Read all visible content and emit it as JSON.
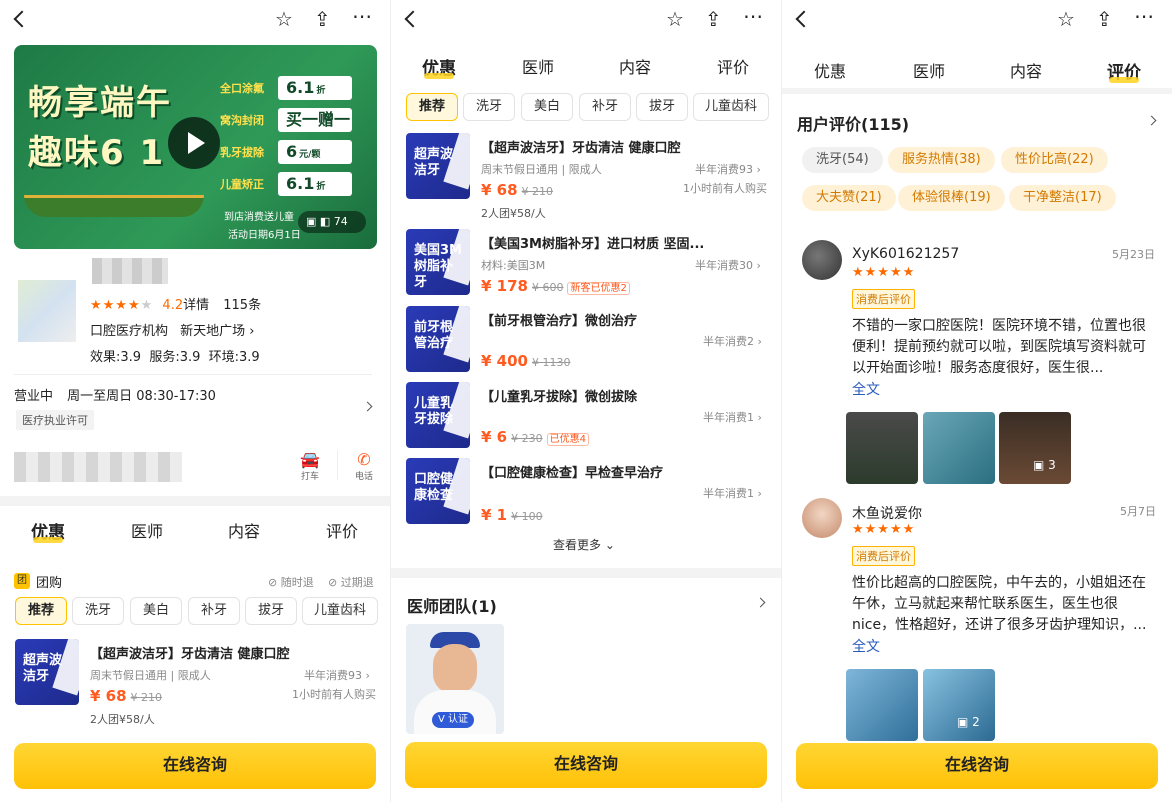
{
  "p1": {
    "banner": {
      "headline1": "畅享端午",
      "headline2": "趣味6 1",
      "offers": [
        {
          "label": "全口涂氟",
          "value": "6.1",
          "unit": "折"
        },
        {
          "label": "窝沟封闭",
          "value": "买一赠一",
          "unit": ""
        },
        {
          "label": "乳牙拔除",
          "value": "6",
          "unit": "元/颗"
        },
        {
          "label": "儿童矫正",
          "value": "6.1",
          "unit": "折"
        }
      ],
      "footnote1": "到店消费送儿童",
      "footnote2": "活动日期6月1日",
      "media_count": "74"
    },
    "rating_value": "4.2",
    "rating_details": "详情",
    "review_count": "115条",
    "category": "口腔医疗机构",
    "area": "新天地广场",
    "scores": "效果:3.9  服务:3.9  环境:3.9",
    "hours_status": "营业中",
    "hours_text": "周一至周日 08:30-17:30",
    "license": "医疗执业许可",
    "taxi_label": "打车",
    "phone_label": "电话",
    "tabs": [
      "优惠",
      "医师",
      "内容",
      "评价"
    ],
    "group_badge": "团",
    "group_title": "团购",
    "refund1": "随时退",
    "refund2": "过期退",
    "chips": [
      "推荐",
      "洗牙",
      "美白",
      "补牙",
      "拔牙",
      "儿童齿科"
    ],
    "deal": {
      "img_text": "超声波洁牙",
      "title": "【超声波洁牙】牙齿清洁 健康口腔",
      "sub": "周末节假日通用 | 限成人",
      "price": "¥ 68",
      "orig": "¥ 210",
      "sold": "半年消费93",
      "recent": "1小时前有人购买",
      "group": "2人团¥58/人"
    },
    "cta": "在线咨询"
  },
  "p2": {
    "tabs": [
      "优惠",
      "医师",
      "内容",
      "评价"
    ],
    "chips": [
      "推荐",
      "洗牙",
      "美白",
      "补牙",
      "拔牙",
      "儿童齿科"
    ],
    "deals": [
      {
        "img": "超声波洁牙",
        "title": "【超声波洁牙】牙齿清洁 健康口腔",
        "sub": "周末节假日通用 | 限成人",
        "price": "¥ 68",
        "orig": "¥ 210",
        "coupon": "",
        "sold": "半年消费93",
        "recent": "1小时前有人购买",
        "group": "2人团¥58/人"
      },
      {
        "img": "美国3M树脂补牙",
        "title": "【美国3M树脂补牙】进口材质 坚固...",
        "sub": "材料:美国3M",
        "price": "¥ 178",
        "orig": "¥ 600",
        "coupon": "新客已优惠2",
        "sold": "半年消费30",
        "recent": "",
        "group": ""
      },
      {
        "img": "前牙根管治疗",
        "title": "【前牙根管治疗】微创治疗",
        "sub": "",
        "price": "¥ 400",
        "orig": "¥ 1130",
        "coupon": "",
        "sold": "半年消费2",
        "recent": "",
        "group": ""
      },
      {
        "img": "儿童乳牙拔除",
        "title": "【儿童乳牙拔除】微创拔除",
        "sub": "",
        "price": "¥ 6",
        "orig": "¥ 230",
        "coupon": "已优惠4",
        "sold": "半年消费1",
        "recent": "",
        "group": ""
      },
      {
        "img": "口腔健康检查",
        "title": "【口腔健康检查】早检查早治疗",
        "sub": "",
        "price": "¥ 1",
        "orig": "¥ 100",
        "coupon": "",
        "sold": "半年消费1",
        "recent": "",
        "group": ""
      }
    ],
    "more": "查看更多",
    "team_title": "医师团队(1)",
    "verified": "认证",
    "cta": "在线咨询"
  },
  "p3": {
    "tabs": [
      "优惠",
      "医师",
      "内容",
      "评价"
    ],
    "reviews_title": "用户评价(115)",
    "tags_grey": [
      "洗牙(54)"
    ],
    "tags": [
      {
        "text": "洗牙(54)",
        "style": "g"
      },
      {
        "text": "服务热情(38)",
        "style": "o"
      },
      {
        "text": "性价比高(22)",
        "style": "o"
      },
      {
        "text": "大夫赞(21)",
        "style": "o"
      },
      {
        "text": "体验很棒(19)",
        "style": "o"
      },
      {
        "text": "干净整洁(17)",
        "style": "o"
      }
    ],
    "reviews": [
      {
        "user": "XyK601621257",
        "date": "5月23日",
        "badge": "消费后评价",
        "text": "不错的一家口腔医院！医院环境不错，位置也很便利！提前预约就可以啦，到医院填写资料就可以开始面诊啦！服务态度很好，医生很...",
        "full": "全文",
        "photo_count": "3"
      },
      {
        "user": "木鱼说爱你",
        "date": "5月7日",
        "badge": "消费后评价",
        "text": "性价比超高的口腔医院，中午去的，小姐姐还在午休，立马就起来帮忙联系医生，医生也很nice，性格超好，还讲了很多牙齿护理知识，...",
        "full": "全文",
        "photo_count": "2"
      }
    ],
    "cta": "在线咨询"
  }
}
